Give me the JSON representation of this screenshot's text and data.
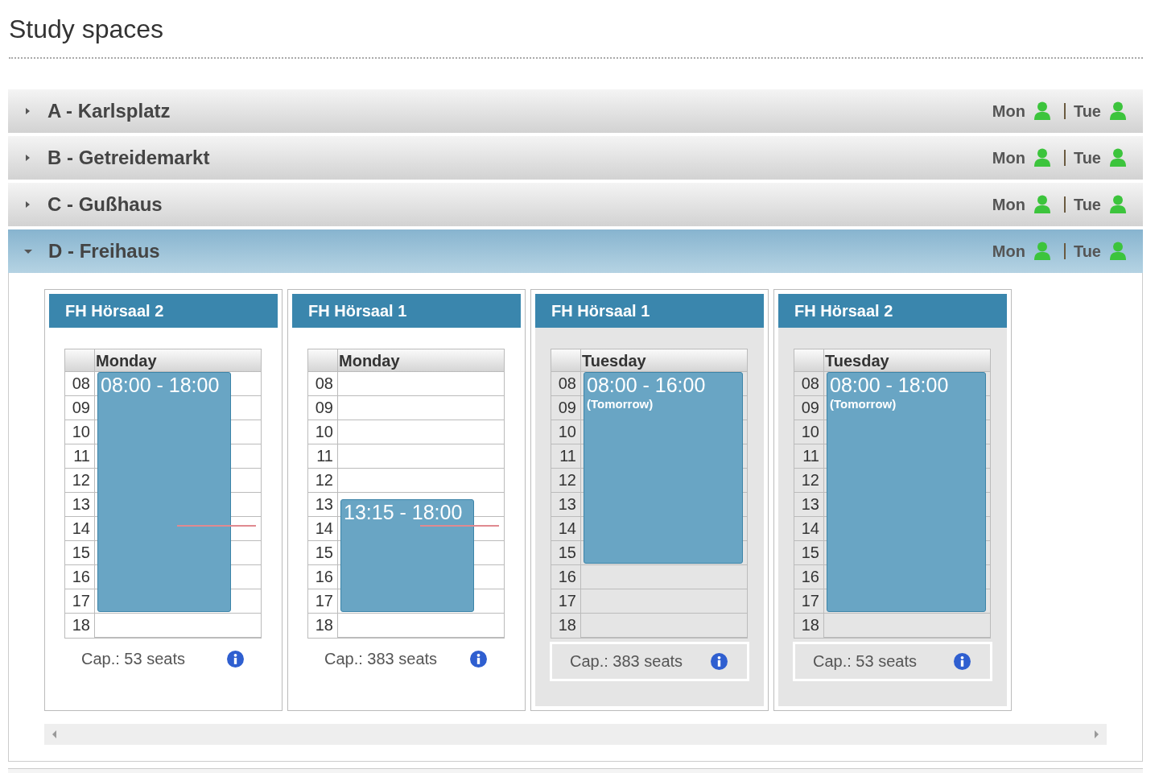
{
  "page": {
    "title": "Study spaces"
  },
  "buildings": [
    {
      "label": "A - Karlsplatz",
      "expanded": false,
      "days": [
        {
          "label": "Mon"
        },
        {
          "label": "Tue"
        }
      ]
    },
    {
      "label": "B - Getreidemarkt",
      "expanded": false,
      "days": [
        {
          "label": "Mon"
        },
        {
          "label": "Tue"
        }
      ]
    },
    {
      "label": "C - Gußhaus",
      "expanded": false,
      "days": [
        {
          "label": "Mon"
        },
        {
          "label": "Tue"
        }
      ]
    },
    {
      "label": "D - Freihaus",
      "expanded": true,
      "days": [
        {
          "label": "Mon"
        },
        {
          "label": "Tue"
        }
      ]
    }
  ],
  "rooms": [
    {
      "name": "FH Hörsaal 2",
      "tomorrow": false,
      "day": "Monday",
      "hours": [
        "08",
        "09",
        "10",
        "11",
        "12",
        "13",
        "14",
        "15",
        "16",
        "17",
        "18"
      ],
      "bookings": [
        {
          "time": "08:00 - 18:00"
        }
      ],
      "capacity": "Cap.: 53 seats"
    },
    {
      "name": "FH Hörsaal 1",
      "tomorrow": false,
      "day": "Monday",
      "hours": [
        "08",
        "09",
        "10",
        "11",
        "12",
        "13",
        "14",
        "15",
        "16",
        "17",
        "18"
      ],
      "bookings": [
        {
          "time": "13:15 - 18:00"
        }
      ],
      "capacity": "Cap.: 383 seats"
    },
    {
      "name": "FH Hörsaal 1",
      "tomorrow": true,
      "day": "Tuesday",
      "hours": [
        "08",
        "09",
        "10",
        "11",
        "12",
        "13",
        "14",
        "15",
        "16",
        "17",
        "18"
      ],
      "bookings": [
        {
          "time": "08:00 - 16:00",
          "note": "(Tomorrow)"
        }
      ],
      "capacity": "Cap.: 383 seats"
    },
    {
      "name": "FH Hörsaal 2",
      "tomorrow": true,
      "day": "Tuesday",
      "hours": [
        "08",
        "09",
        "10",
        "11",
        "12",
        "13",
        "14",
        "15",
        "16",
        "17",
        "18"
      ],
      "bookings": [
        {
          "time": "08:00 - 18:00",
          "note": "(Tomorrow)"
        }
      ],
      "capacity": "Cap.: 53 seats"
    }
  ]
}
